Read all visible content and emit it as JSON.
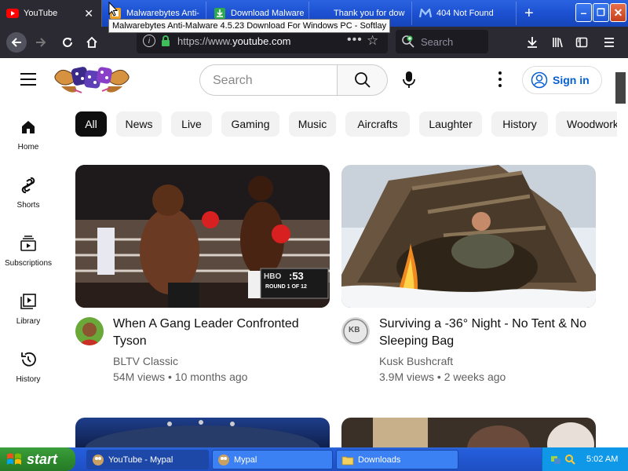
{
  "browser": {
    "tabs": [
      {
        "title": "YouTube",
        "favicon": "youtube-icon",
        "active": true
      },
      {
        "title": "Malwarebytes Anti-",
        "favicon": "softlay-icon",
        "active": false
      },
      {
        "title": "Download Malware",
        "favicon": "download-icon",
        "active": false
      },
      {
        "title": "Thank you for dow",
        "favicon": "blank-icon",
        "active": false
      },
      {
        "title": "404 Not Found",
        "favicon": "m-icon",
        "active": false
      }
    ],
    "tooltip": "Malwarebytes Anti-Malware 4.5.23 Download For Windows PC - Softlay",
    "url_prefix": "https://www.",
    "url_domain": "youtube.com",
    "search_placeholder": "Search"
  },
  "youtube": {
    "search_placeholder": "Search",
    "sign_in": "Sign in",
    "sidebar": [
      {
        "label": "Home",
        "icon": "home-icon"
      },
      {
        "label": "Shorts",
        "icon": "shorts-icon"
      },
      {
        "label": "Subscriptions",
        "icon": "subscriptions-icon"
      },
      {
        "label": "Library",
        "icon": "library-icon"
      },
      {
        "label": "History",
        "icon": "history-icon"
      }
    ],
    "chips": [
      "All",
      "News",
      "Live",
      "Gaming",
      "Music",
      "Aircrafts",
      "Laughter",
      "History",
      "Woodworking"
    ],
    "videos": [
      {
        "title": "When A Gang Leader Confronted Tyson",
        "channel": "BLTV Classic",
        "meta": "54M views • 10 months ago",
        "overlay_time": ":53",
        "overlay_round": "ROUND 1 OF 12",
        "overlay_brand": "HBO"
      },
      {
        "title": "Surviving a -36° Night - No Tent & No Sleeping Bag",
        "channel": "Kusk Bushcraft",
        "meta": "3.9M views • 2 weeks ago",
        "avatar_text": "KB"
      }
    ]
  },
  "taskbar": {
    "start": "start",
    "buttons": [
      {
        "label": "YouTube - Mypal",
        "icon": "mypal-icon",
        "active": true
      },
      {
        "label": "Mypal",
        "icon": "mypal-icon",
        "active": false
      },
      {
        "label": "Downloads",
        "icon": "folder-icon",
        "active": false
      }
    ],
    "clock": "5:02 AM"
  },
  "colors": {
    "xp_blue": "#245ddb",
    "firefox_dark": "#2b2a33",
    "youtube_red": "#ff0000",
    "signin_blue": "#065fd4"
  }
}
